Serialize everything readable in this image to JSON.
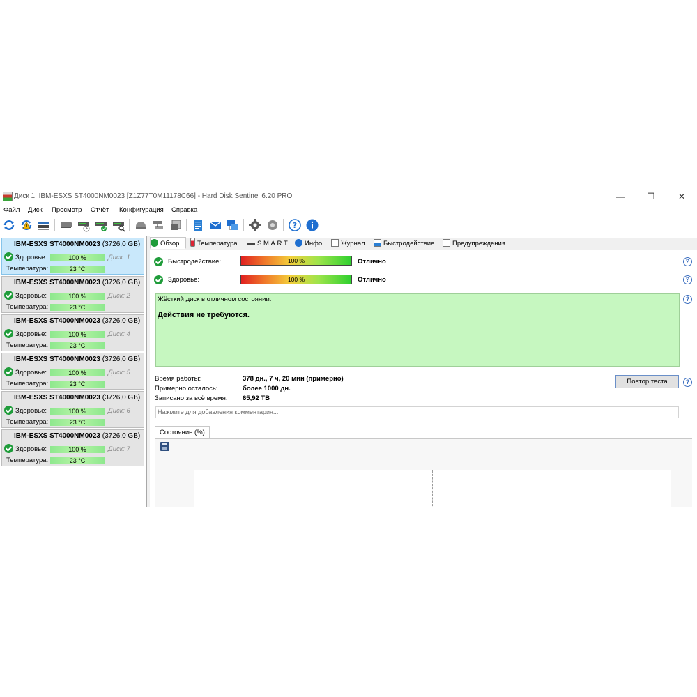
{
  "window": {
    "title": "Диск 1, IBM-ESXS ST4000NM0023 [Z1Z77T0M11178C66]  -  Hard Disk Sentinel 6.20 PRO"
  },
  "menu": [
    "Файл",
    "Диск",
    "Просмотр",
    "Отчёт",
    "Конфигурация",
    "Справка"
  ],
  "toolbar_icons": [
    "refresh-icon",
    "refresh-warning-icon",
    "disk-list-icon",
    "disk-icon",
    "disk-schedule-icon",
    "disk-check-icon",
    "disk-search-icon",
    "hdd-icon",
    "disk-transfer-icon",
    "disk-copy-icon",
    "report-icon",
    "email-icon",
    "network-icon",
    "settings-icon",
    "sound-icon",
    "help-icon",
    "info-icon"
  ],
  "disks": [
    {
      "name": "IBM-ESXS ST4000NM0023",
      "size": "(3726,0 GB)",
      "health_label": "Здоровье:",
      "health": "100 %",
      "health_pct": 100,
      "temp_label": "Температура:",
      "temp": "23 °C",
      "num": "Диск: 1",
      "selected": true
    },
    {
      "name": "IBM-ESXS ST4000NM0023",
      "size": "(3726,0 GB)",
      "health_label": "Здоровье:",
      "health": "100 %",
      "health_pct": 100,
      "temp_label": "Температура:",
      "temp": "23 °C",
      "num": "Диск: 2",
      "selected": false
    },
    {
      "name": "IBM-ESXS ST4000NM0023",
      "size": "(3726,0 GB)",
      "health_label": "Здоровье:",
      "health": "100 %",
      "health_pct": 100,
      "temp_label": "Температура:",
      "temp": "23 °C",
      "num": "Диск: 4",
      "selected": false
    },
    {
      "name": "IBM-ESXS ST4000NM0023",
      "size": "(3726,0 GB)",
      "health_label": "Здоровье:",
      "health": "100 %",
      "health_pct": 100,
      "temp_label": "Температура:",
      "temp": "23 °C",
      "num": "Диск: 5",
      "selected": false
    },
    {
      "name": "IBM-ESXS ST4000NM0023",
      "size": "(3726,0 GB)",
      "health_label": "Здоровье:",
      "health": "100 %",
      "health_pct": 100,
      "temp_label": "Температура:",
      "temp": "23 °C",
      "num": "Диск: 6",
      "selected": false
    },
    {
      "name": "IBM-ESXS ST4000NM0023",
      "size": "(3726,0 GB)",
      "health_label": "Здоровье:",
      "health": "100 %",
      "health_pct": 100,
      "temp_label": "Температура:",
      "temp": "23 °C",
      "num": "Диск: 7",
      "selected": false
    }
  ],
  "tabs": [
    "Обзор",
    "Температура",
    "S.M.A.R.T.",
    "Инфо",
    "Журнал",
    "Быстродействие",
    "Предупреждения"
  ],
  "overview": {
    "performance_label": "Быстродействие:",
    "performance": "100 %",
    "performance_pct": 100,
    "performance_rating": "Отлично",
    "health_label": "Здоровье:",
    "health": "100 %",
    "health_pct": 100,
    "health_rating": "Отлично",
    "status_line": "Жёсткий диск в отличном состоянии.",
    "status_action": "Действия не требуются.",
    "uptime_label": "Время работы:",
    "uptime": "378 дн., 7 ч, 20 мин (примерно)",
    "remaining_label": "Примерно осталось:",
    "remaining": "более 1000 дн.",
    "written_label": "Записано за всё время:",
    "written": "65,92 TB",
    "retest_button": "Повтор теста",
    "comment_placeholder": "Нажмите для добавления комментария...",
    "subtab": "Состояние (%)"
  },
  "colors": {
    "ok_green": "#1f9c3a",
    "status_bg": "#c6f7c0",
    "health_bar": "#8ee88e",
    "selected_disk": "#c9e8fb"
  }
}
